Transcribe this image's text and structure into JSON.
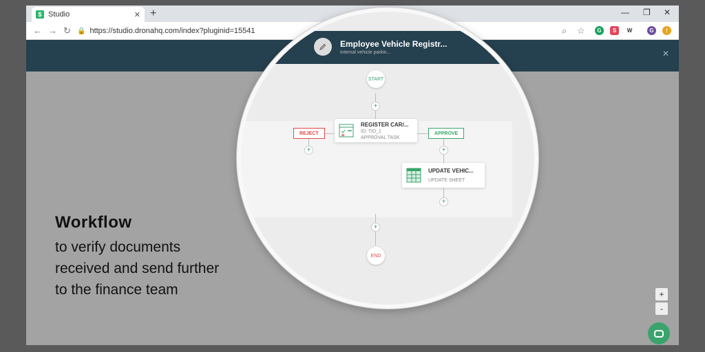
{
  "browser": {
    "tab_title": "Studio",
    "favicon": "$",
    "url": "https://studio.dronahq.com/index?pluginid=15541",
    "extensions": [
      "G",
      "S",
      "W",
      "G",
      "!"
    ]
  },
  "app": {
    "workflow_title": "Employee Vehicle Registr...",
    "workflow_subtitle": "internal vehicle parkin..."
  },
  "workflow": {
    "start_label": "START",
    "end_label": "END",
    "reject_label": "REJECT",
    "approve_label": "APPROVE",
    "task1": {
      "title": "REGISTER CAR/...",
      "id": "ID: TID_1",
      "type": "APPROVAL TASK"
    },
    "task2": {
      "title": "UPDATE VEHIC...",
      "type": "UPDATE SHEET"
    }
  },
  "zoom": {
    "plus": "+",
    "minus": "-"
  },
  "caption": {
    "title": "Workflow",
    "lines": [
      "to verify documents",
      "received and send further",
      "to the finance team"
    ]
  },
  "colors": {
    "header": "#25404f",
    "reject": "#e04848",
    "approve": "#3aa46c",
    "chat": "#3aa46c"
  }
}
